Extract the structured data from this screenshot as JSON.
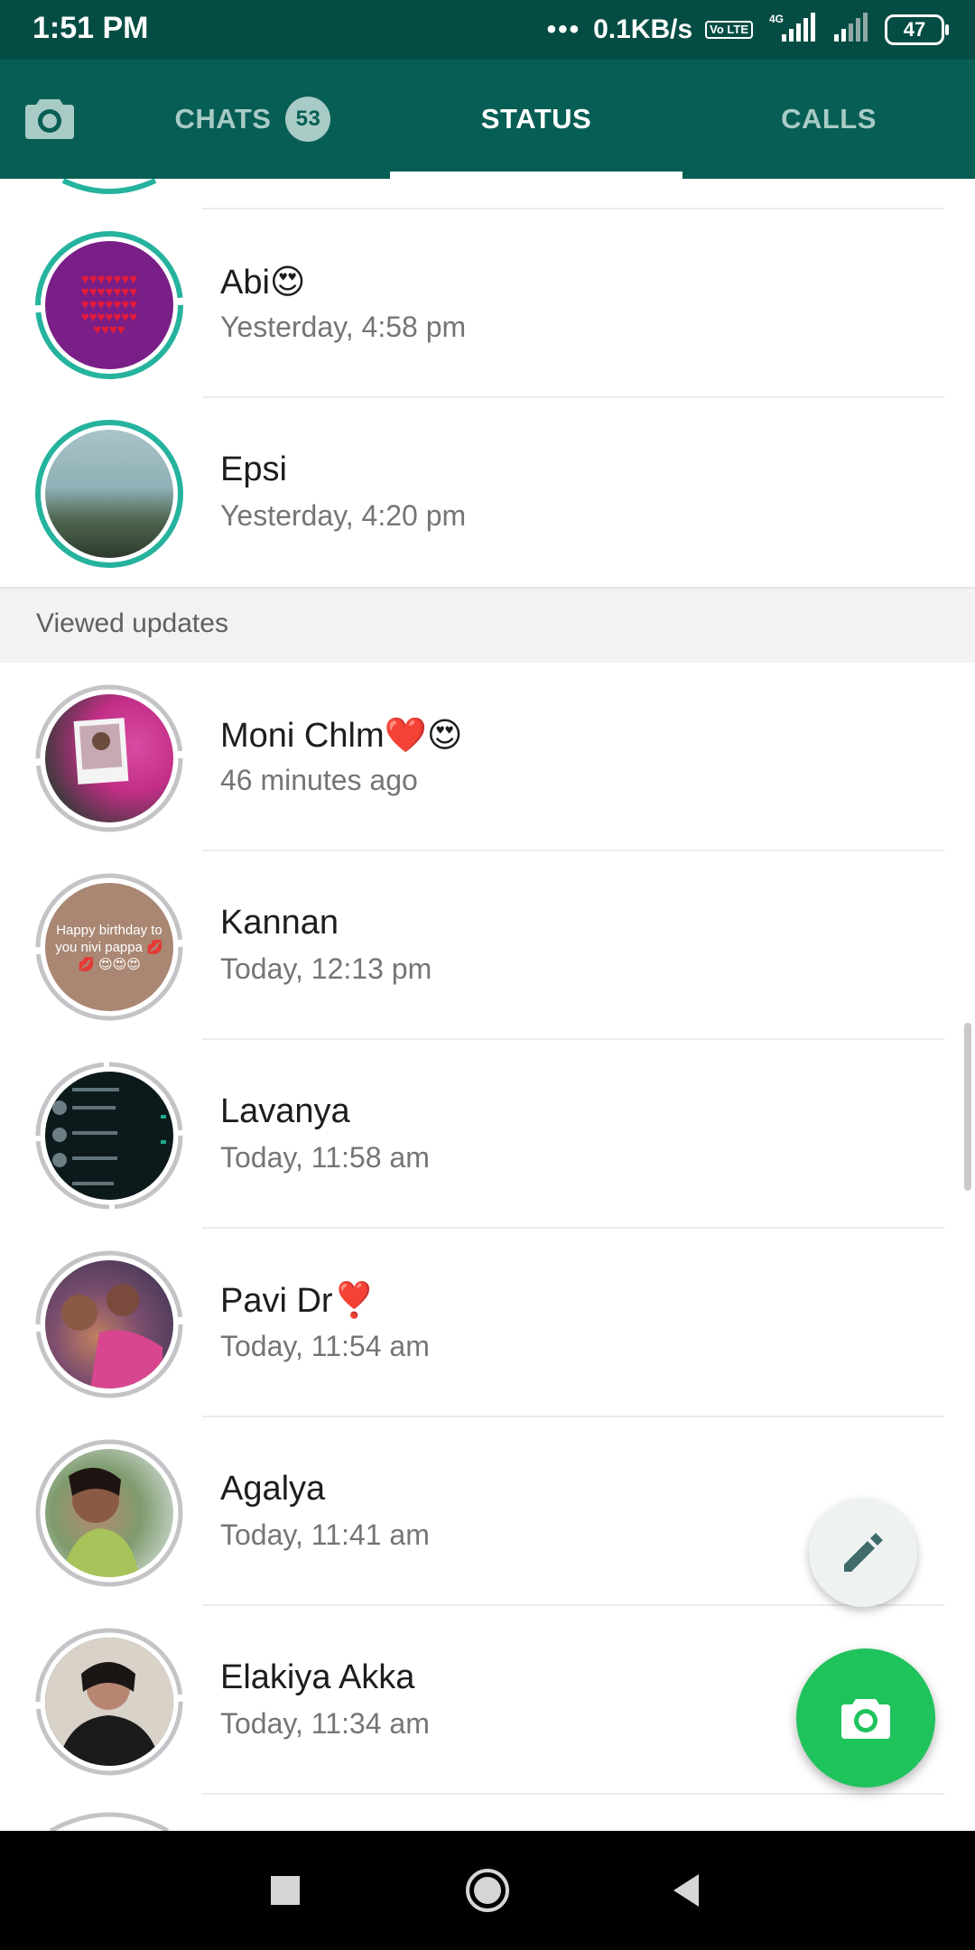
{
  "status_bar": {
    "time": "1:51 PM",
    "network_speed": "0.1KB/s",
    "volte": "Vo LTE",
    "network_type": "4G",
    "battery": "47"
  },
  "tabs": {
    "chats": {
      "label": "CHATS",
      "badge": "53"
    },
    "status": {
      "label": "STATUS",
      "selected": true
    },
    "calls": {
      "label": "CALLS"
    }
  },
  "recent_updates": [
    {
      "name": "Abi😍",
      "time": "Yesterday, 4:58 pm"
    },
    {
      "name": "Epsi",
      "time": "Yesterday, 4:20 pm"
    }
  ],
  "viewed_header": "Viewed updates",
  "viewed_updates": [
    {
      "name": "Moni Chlm❤️😍",
      "time": "46 minutes ago"
    },
    {
      "name": "Kannan",
      "time": "Today, 12:13 pm",
      "thumbnail_text": "Happy birthday to you nivi pappa 💋💋 😍😍😍"
    },
    {
      "name": "Lavanya",
      "time": "Today, 11:58 am"
    },
    {
      "name": "Pavi Dr❣️",
      "time": "Today, 11:54 am"
    },
    {
      "name": "Agalya",
      "time": "Today, 11:41 am"
    },
    {
      "name": "Elakiya Akka",
      "time": "Today, 11:34 am"
    }
  ],
  "colors": {
    "header": "#075e54",
    "status_bar": "#054d44",
    "unviewed_ring": "#25b39e",
    "viewed_ring": "#c4c4c8",
    "camera_fab": "#1fc35b"
  },
  "icons": {
    "camera_tab": "camera-icon",
    "edit_fab": "pencil-icon",
    "camera_fab": "camera-icon",
    "nav": [
      "square-recents-icon",
      "circle-home-icon",
      "triangle-back-icon"
    ]
  }
}
